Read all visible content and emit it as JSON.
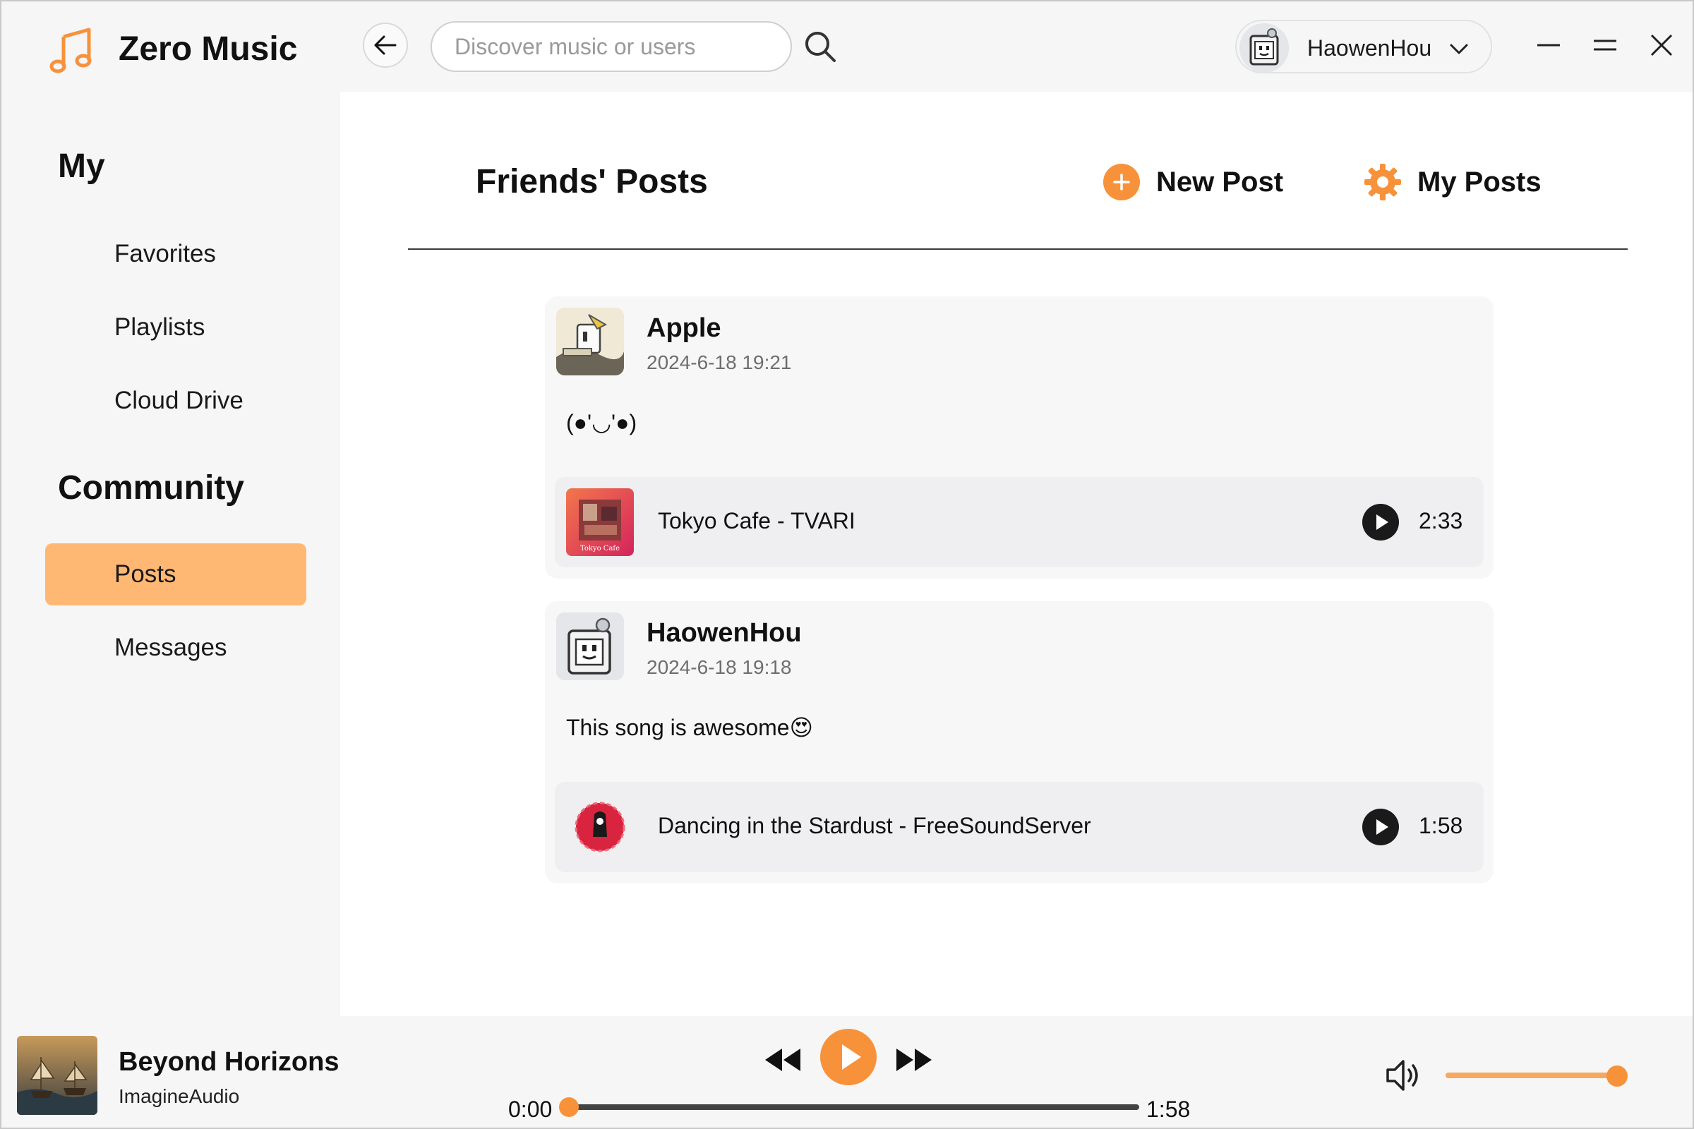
{
  "app": {
    "title": "Zero Music"
  },
  "header": {
    "search_placeholder": "Discover music or users",
    "user_name": "HaowenHou"
  },
  "sidebar": {
    "my_heading": "My",
    "my_items": [
      {
        "label": "Favorites"
      },
      {
        "label": "Playlists"
      },
      {
        "label": "Cloud Drive"
      }
    ],
    "community_heading": "Community",
    "community_items": [
      {
        "label": "Posts",
        "active": true
      },
      {
        "label": "Messages",
        "active": false
      }
    ]
  },
  "main": {
    "title": "Friends' Posts",
    "new_post_label": "New Post",
    "my_posts_label": "My Posts",
    "posts": [
      {
        "author": "Apple",
        "time": "2024-6-18 19:21",
        "text": "(●'◡'●)",
        "song": {
          "title": "Tokyo Cafe - TVARI",
          "duration": "2:33"
        }
      },
      {
        "author": "HaowenHou",
        "time": "2024-6-18 19:18",
        "text": "This song is awesome😍",
        "song": {
          "title": "Dancing in the Stardust - FreeSoundServer",
          "duration": "1:58"
        }
      }
    ]
  },
  "player": {
    "title": "Beyond Horizons",
    "artist": "ImagineAudio",
    "current_time": "0:00",
    "total_time": "1:58",
    "progress": 0.0,
    "volume": 0.94
  },
  "colors": {
    "accent": "#f7923a",
    "active_nav": "#ffb873"
  }
}
